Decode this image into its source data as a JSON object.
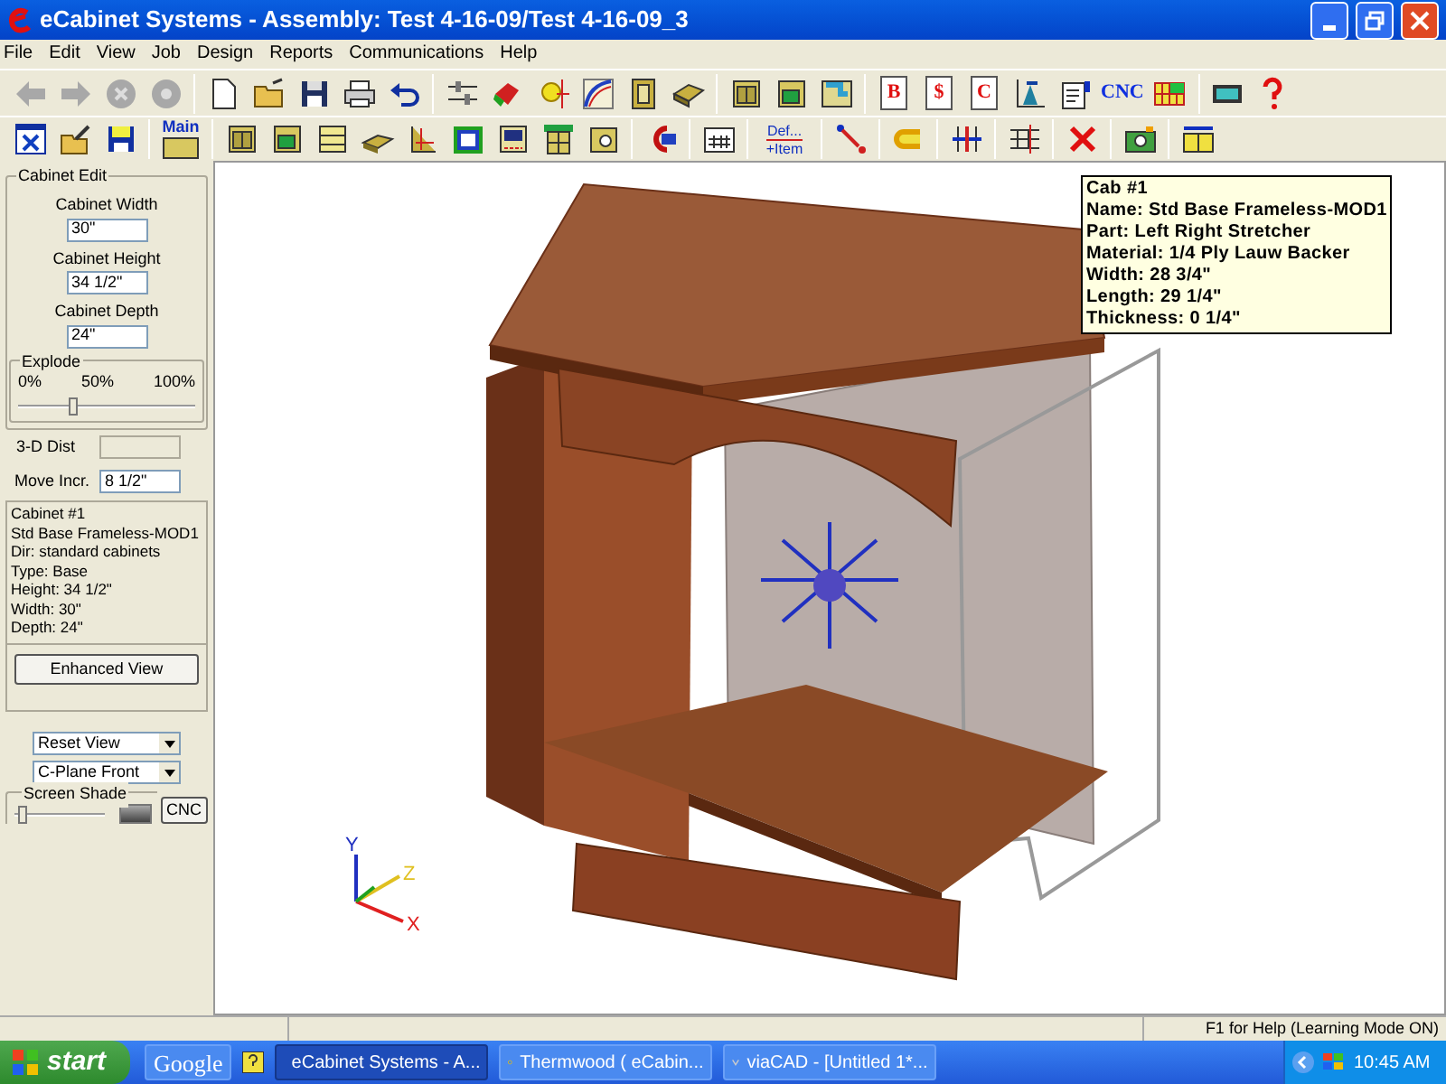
{
  "window": {
    "title": "eCabinet Systems - Assembly: Test 4-16-09/Test 4-16-09_3"
  },
  "menu": [
    "File",
    "Edit",
    "View",
    "Job",
    "Design",
    "Reports",
    "Communications",
    "Help"
  ],
  "toolbar_1": {
    "report_letters": [
      "B",
      "$",
      "C"
    ],
    "cnc": "CNC"
  },
  "toolbar_2": {
    "main": "Main",
    "def_top": "Def...",
    "def_bottom": "+Item"
  },
  "cabinet_edit": {
    "title": "Cabinet Edit",
    "fields": [
      {
        "label": "Cabinet Width",
        "value": "30\""
      },
      {
        "label": "Cabinet Height",
        "value": "34 1/2\""
      },
      {
        "label": "Cabinet Depth",
        "value": "24\""
      }
    ],
    "explode": {
      "title": "Explode",
      "ticks": [
        "0%",
        "50%",
        "100%"
      ],
      "level": 0.3
    },
    "dist_label": "3-D Dist",
    "move_label": "Move Incr.",
    "move_value": "8 1/2\"",
    "info": [
      "Cabinet #1",
      "Std Base Frameless-MOD1",
      "Dir: standard cabinets",
      "Type: Base",
      "Height: 34 1/2\"",
      "Width: 30\"",
      "Depth: 24\""
    ],
    "enhanced_button": "Enhanced View",
    "view_select": "Reset View",
    "plane_select": "C-Plane Front",
    "shade": {
      "title": "Screen Shade",
      "level": 0.05
    },
    "cnc_button": "CNC"
  },
  "viewport": {
    "axes": [
      "Y",
      "Z",
      "X"
    ],
    "tooltip": [
      "Cab #1",
      "Name: Std Base Frameless-MOD1",
      "Part: Left Right Stretcher",
      "Material: 1/4 Ply Lauw Backer",
      "Width: 28 3/4\"",
      "Length: 29 1/4\"",
      "Thickness: 0 1/4\""
    ]
  },
  "status_bar": {
    "text": "F1 for Help (Learning Mode ON)"
  },
  "taskbar": {
    "start": "start",
    "search": "Google",
    "tasks": [
      {
        "label": "eCabinet Systems - A...",
        "selected": true
      },
      {
        "label": "Thermwood ( eCabin...",
        "selected": false
      },
      {
        "label": "viaCAD - [Untitled 1*...",
        "selected": false
      }
    ],
    "clock": "10:45 AM"
  }
}
